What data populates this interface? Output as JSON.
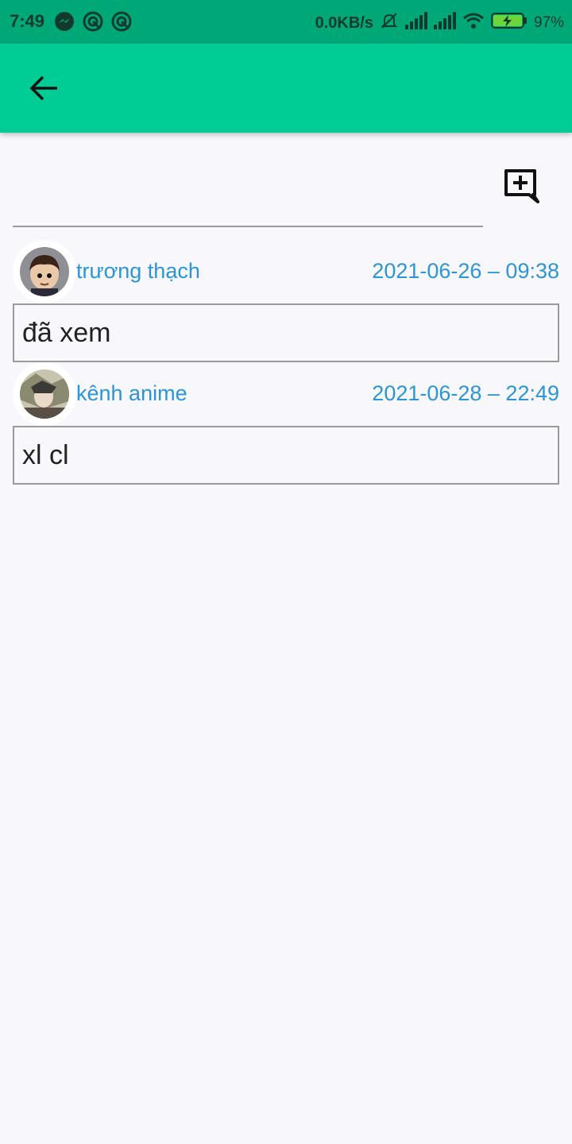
{
  "status_bar": {
    "time": "7:49",
    "net_speed": "0.0KB/s",
    "battery": "97%",
    "icons": [
      "messenger-icon",
      "sync-icon",
      "sync-icon",
      "mute-icon",
      "signal-icon",
      "signal-icon",
      "wifi-icon",
      "battery-charging-icon"
    ]
  },
  "app_bar": {
    "back_icon": "arrow-back-icon",
    "color": "#00cc96"
  },
  "compose": {
    "input_value": "",
    "add_icon": "add-comment-icon"
  },
  "comments": [
    {
      "author": "trương thạch",
      "time": "2021-06-26 – 09:38",
      "text": "đã xem"
    },
    {
      "author": "kênh anime",
      "time": "2021-06-28 – 22:49",
      "text": "xl cl"
    }
  ],
  "colors": {
    "accent": "#2b95d9",
    "status_bar": "#00a877",
    "background": "#f7f7fc"
  }
}
